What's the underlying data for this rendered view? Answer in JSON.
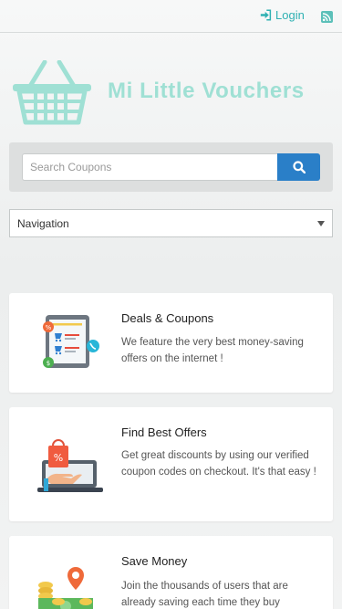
{
  "header": {
    "login_label": "Login",
    "login_icon": "sign-in-icon",
    "rss_icon": "rss-icon"
  },
  "brand": {
    "name": "Mi Little Vouchers",
    "logo_icon": "shopping-basket-icon",
    "color": "#9fe0d4"
  },
  "search": {
    "placeholder": "Search Coupons",
    "value": "",
    "button_icon": "search-icon",
    "button_color": "#2a7fc8"
  },
  "navigation": {
    "selected": "Navigation"
  },
  "features": [
    {
      "title": "Deals & Coupons",
      "text": "We feature the very best money-saving offers on the internet !",
      "icon": "tablet-cart-icon"
    },
    {
      "title": "Find Best Offers",
      "text": "Get great discounts by using our verified coupon codes on checkout. It's that easy !",
      "icon": "laptop-shopping-bag-icon"
    },
    {
      "title": "Save Money",
      "text": "Join the thousands of users that are already saving each time they buy",
      "icon": "coins-location-icon"
    }
  ],
  "colors": {
    "accent": "#2fb1b3",
    "button": "#2a7fc8"
  }
}
